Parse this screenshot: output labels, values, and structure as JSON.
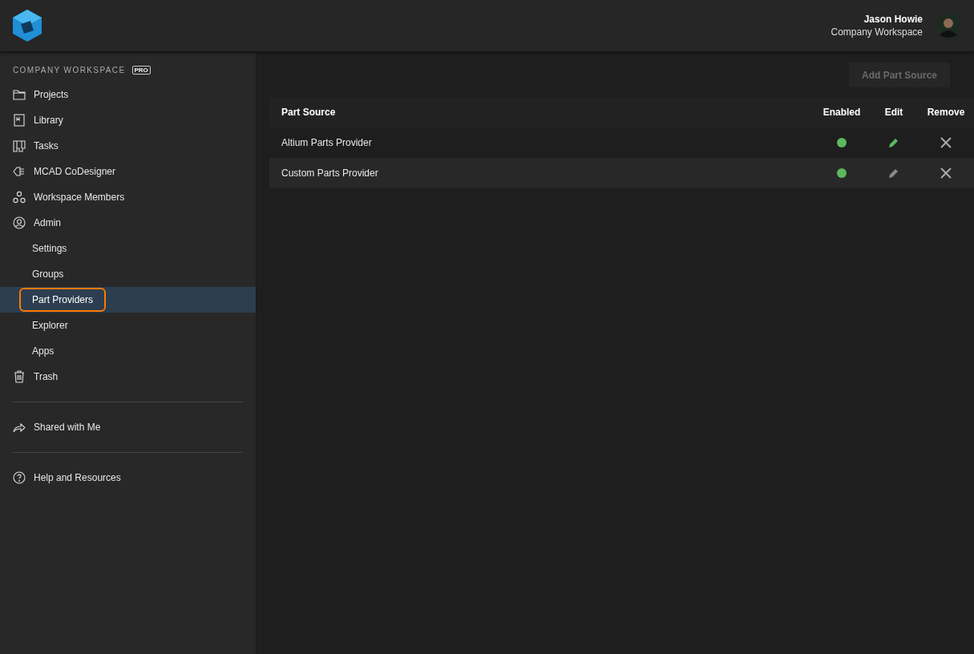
{
  "user": {
    "name": "Jason Howie",
    "workspace": "Company Workspace"
  },
  "sidebar": {
    "workspace_label": "COMPANY WORKSPACE",
    "badge": "PRO",
    "sections": [
      {
        "items": [
          {
            "label": "Projects",
            "selected": false,
            "callout": false
          },
          {
            "label": "Library",
            "selected": false,
            "callout": false
          },
          {
            "label": "Tasks",
            "selected": false,
            "callout": false
          },
          {
            "label": "MCAD CoDesigner",
            "selected": false,
            "callout": false
          },
          {
            "label": "Workspace Members",
            "selected": false,
            "callout": false
          },
          {
            "label": "Admin",
            "selected": false,
            "callout": false,
            "children": [
              {
                "label": "Settings",
                "selected": false,
                "callout": false
              },
              {
                "label": "Groups",
                "selected": false,
                "callout": false
              },
              {
                "label": "Part Providers",
                "selected": true,
                "callout": true
              },
              {
                "label": "Explorer",
                "selected": false,
                "callout": false
              },
              {
                "label": "Apps",
                "selected": false,
                "callout": false
              }
            ]
          },
          {
            "label": "Trash",
            "selected": false,
            "callout": false
          }
        ]
      },
      {
        "items": [
          {
            "label": "Shared with Me",
            "selected": false,
            "callout": false
          }
        ]
      },
      {
        "items": [
          {
            "label": "Help and Resources",
            "selected": false,
            "callout": false
          }
        ]
      }
    ]
  },
  "toolbar": {
    "add_button": {
      "label": "Add Part Source",
      "disabled": true
    }
  },
  "table": {
    "columns": [
      "Part Source",
      "Enabled",
      "Edit",
      "Remove"
    ],
    "rows": [
      {
        "name": "Altium Parts Provider",
        "enabled": true,
        "edit_hovered": true
      },
      {
        "name": "Custom Parts Provider",
        "enabled": true,
        "edit_hovered": false
      }
    ]
  }
}
